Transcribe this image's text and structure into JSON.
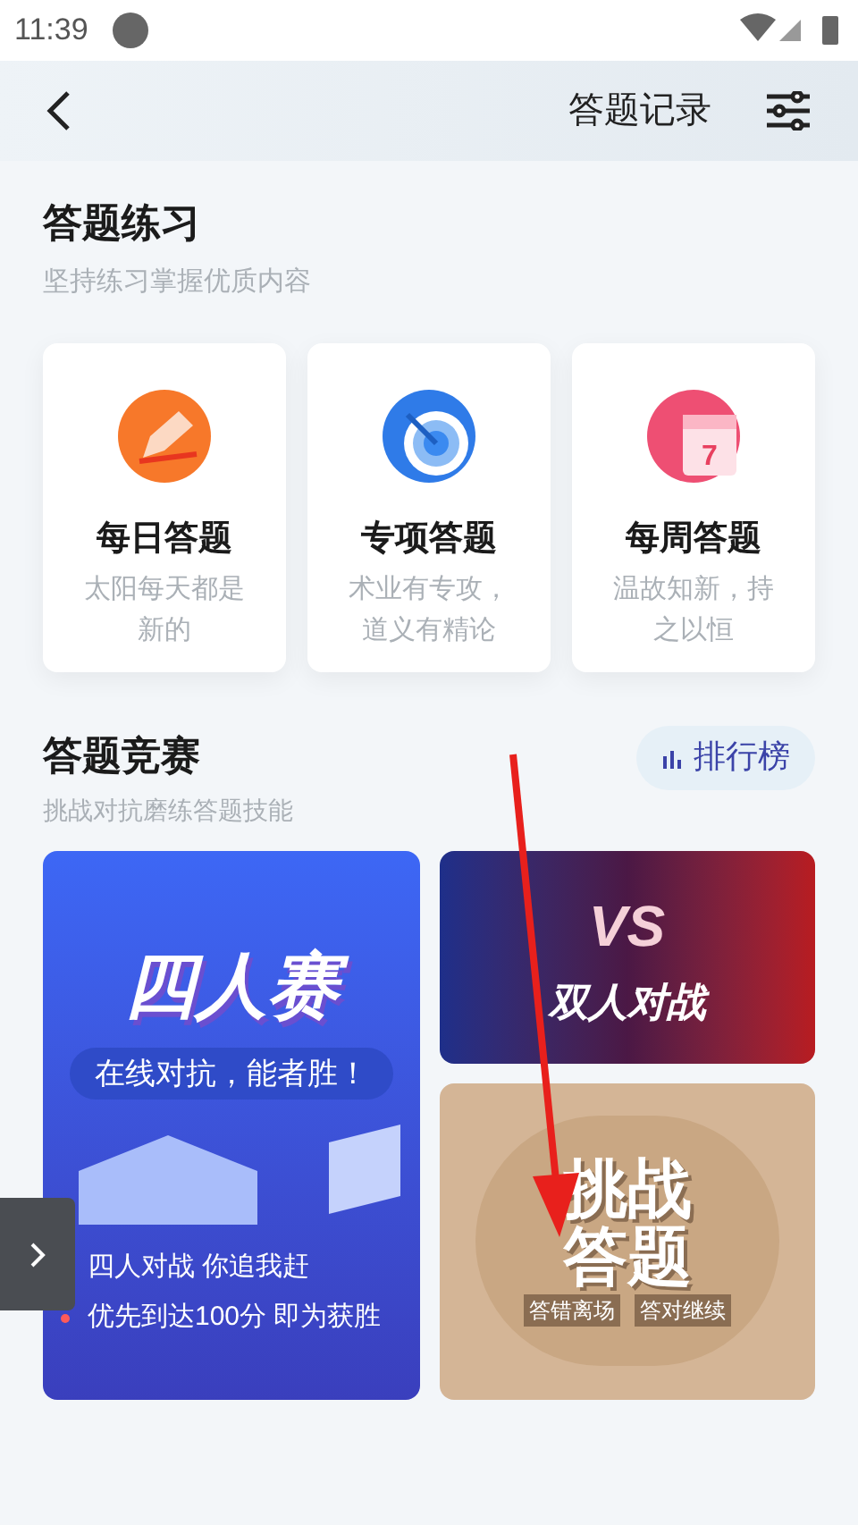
{
  "status_bar": {
    "time": "11:39"
  },
  "header": {
    "record_link": "答题记录"
  },
  "practice": {
    "title": "答题练习",
    "subtitle": "坚持练习掌握优质内容",
    "cards": [
      {
        "kind": "daily",
        "title": "每日答题",
        "desc": "太阳每天都是新的"
      },
      {
        "kind": "special",
        "title": "专项答题",
        "desc": "术业有专攻，道义有精论"
      },
      {
        "kind": "weekly",
        "title": "每周答题",
        "desc": "温故知新，持之以恒",
        "badge": "7"
      }
    ]
  },
  "contest": {
    "title": "答题竞赛",
    "subtitle": "挑战对抗磨练答题技能",
    "ranking_button": "排行榜",
    "four": {
      "title": "四人赛",
      "slogan": "在线对抗，能者胜！",
      "bullets": [
        "四人对战 你追我赶",
        "优先到达100分 即为获胜"
      ]
    },
    "duel": {
      "vs": "VS",
      "title": "双人对战"
    },
    "challenge": {
      "title_top": "挑战",
      "title_bottom": "答题",
      "tag_left": "答错离场",
      "tag_right": "答对继续"
    }
  }
}
